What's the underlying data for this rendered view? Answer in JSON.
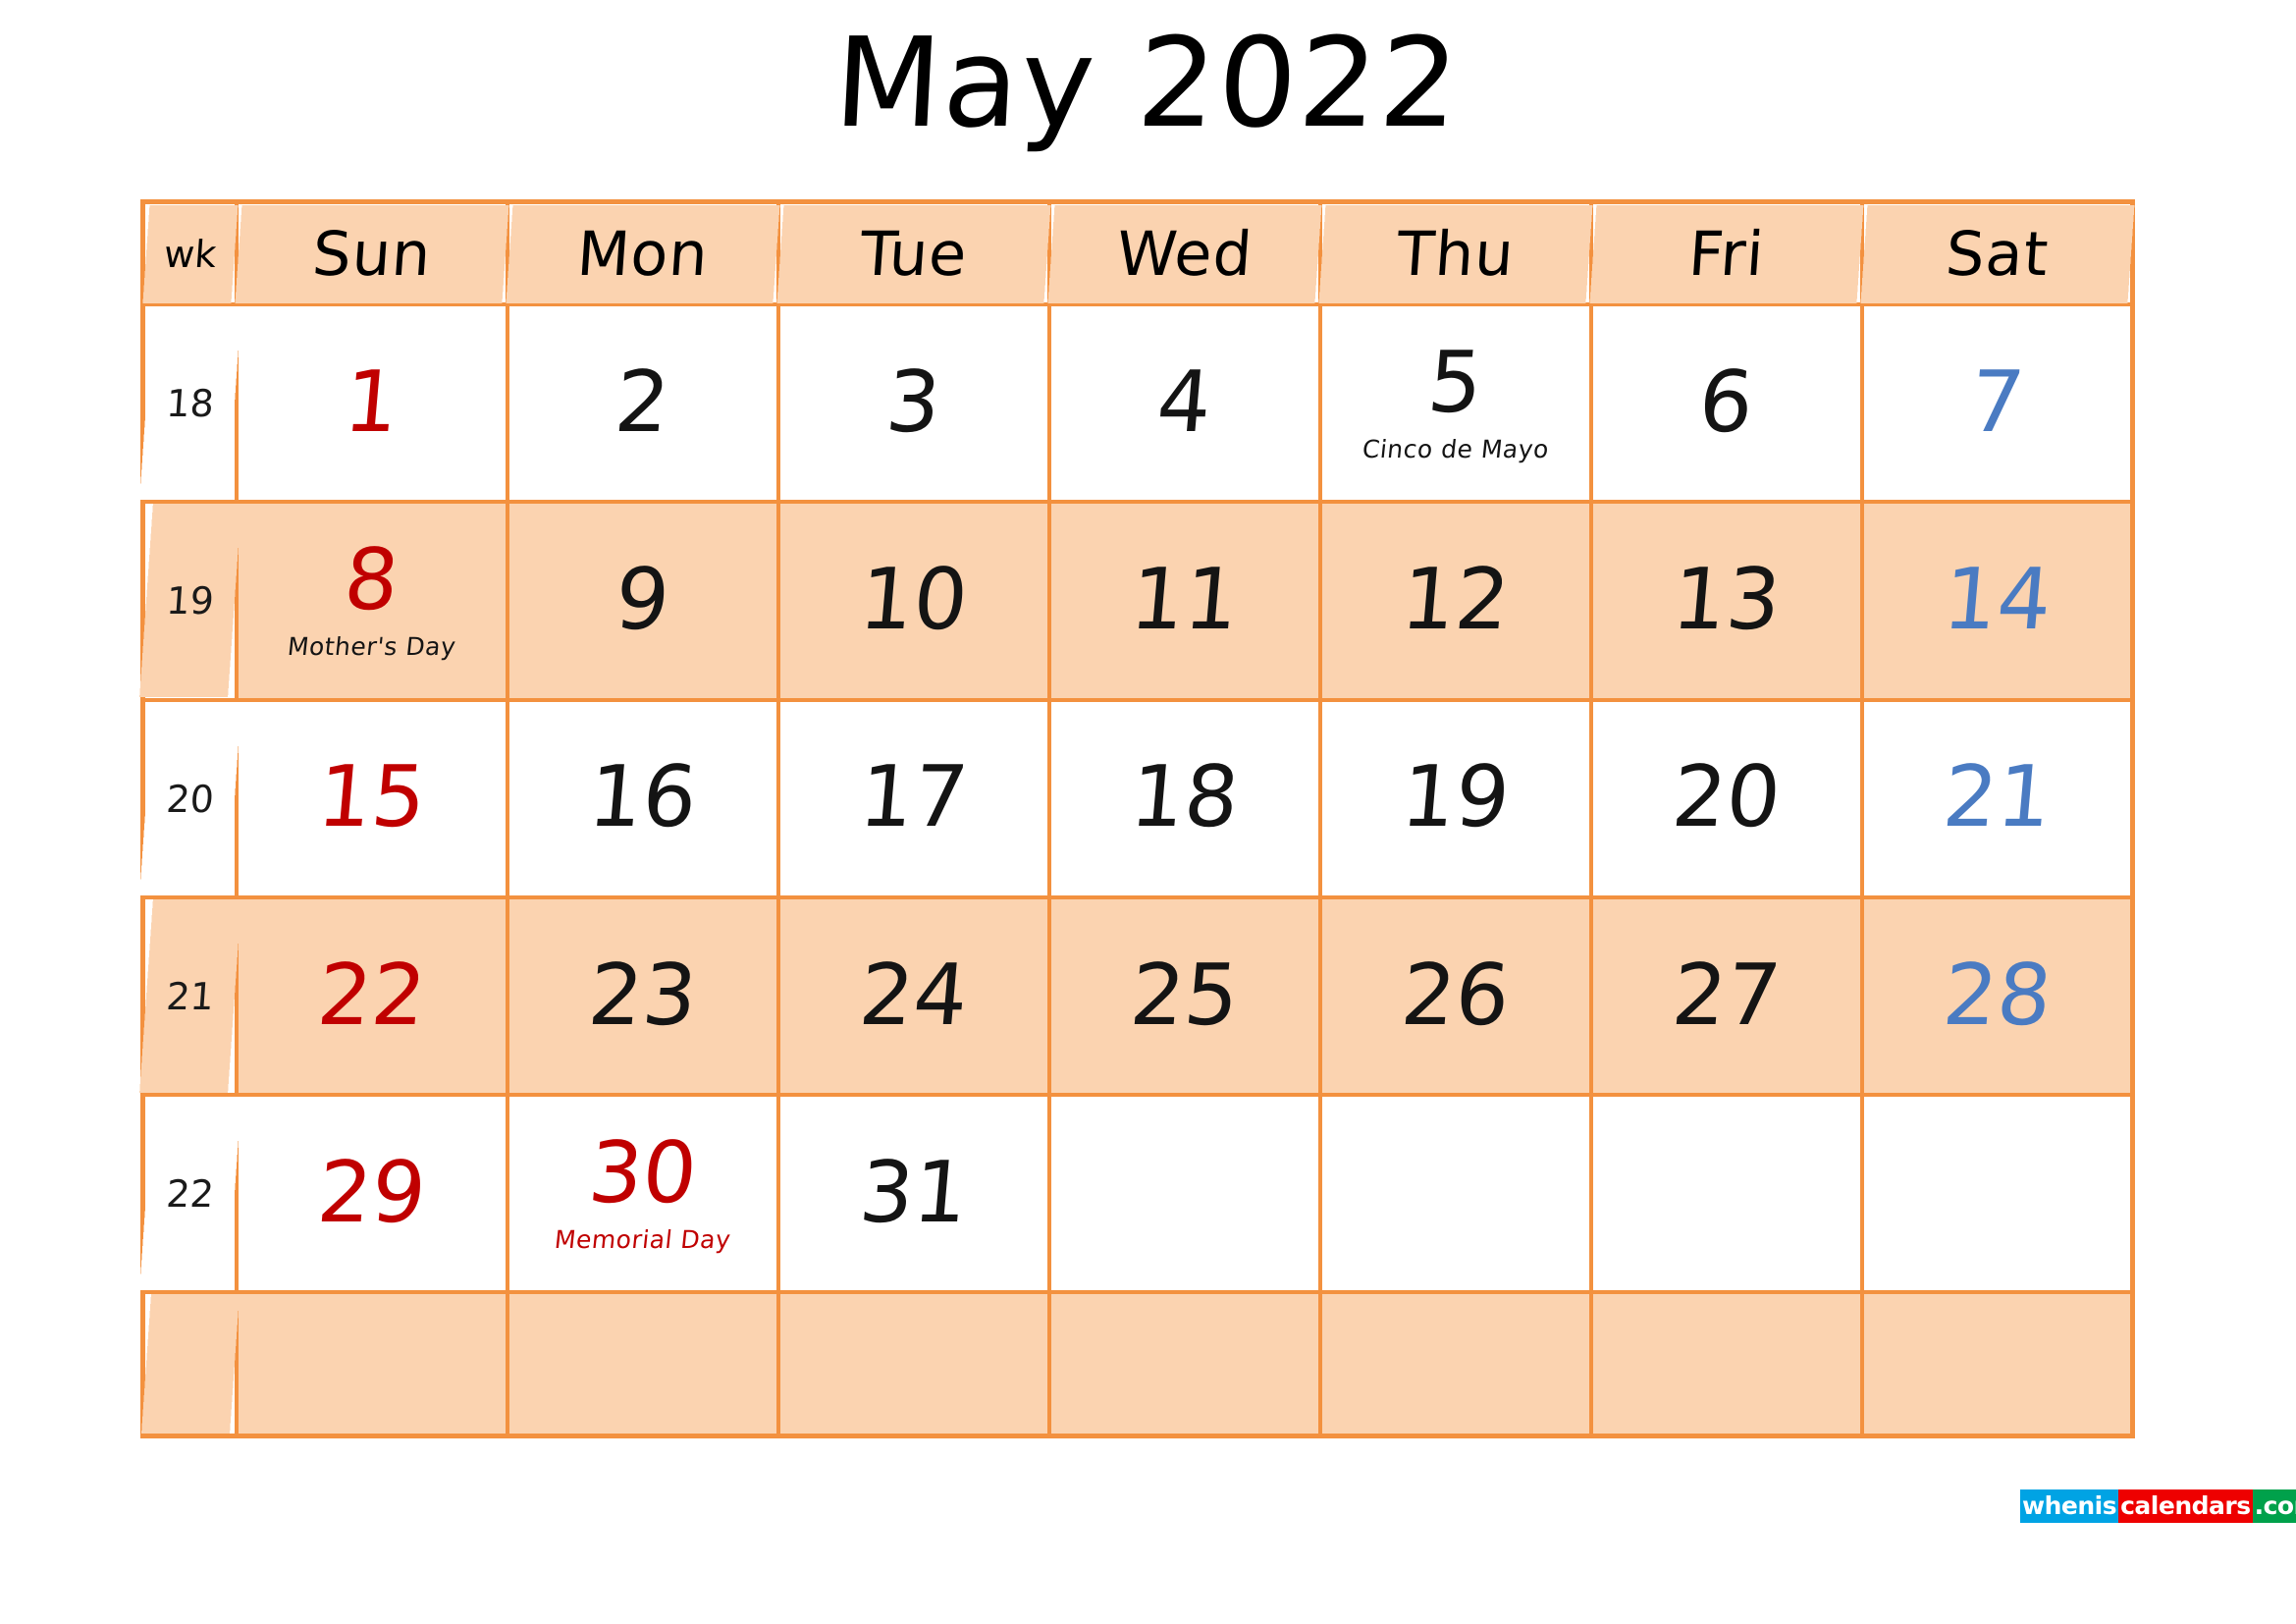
{
  "title": "May 2022",
  "colors": {
    "border": "#f3913f",
    "row_fill": "#fbd3b0",
    "sunday": "#c00000",
    "saturday": "#4a7bc2",
    "weekday": "#141414",
    "logo_blue": "#00a3e4",
    "logo_red": "#ee0000",
    "logo_green": "#00a14b"
  },
  "header": {
    "week_label": "wk",
    "days": [
      "Sun",
      "Mon",
      "Tue",
      "Wed",
      "Thu",
      "Fri",
      "Sat"
    ]
  },
  "weeks": [
    {
      "wk": "18",
      "days": [
        {
          "num": "1",
          "kind": "sunday",
          "note": ""
        },
        {
          "num": "2",
          "kind": "weekday",
          "note": ""
        },
        {
          "num": "3",
          "kind": "weekday",
          "note": ""
        },
        {
          "num": "4",
          "kind": "weekday",
          "note": ""
        },
        {
          "num": "5",
          "kind": "weekday",
          "note": "Cinco de Mayo"
        },
        {
          "num": "6",
          "kind": "weekday",
          "note": ""
        },
        {
          "num": "7",
          "kind": "saturday",
          "note": ""
        }
      ]
    },
    {
      "wk": "19",
      "days": [
        {
          "num": "8",
          "kind": "sunday",
          "note": "Mother's Day"
        },
        {
          "num": "9",
          "kind": "weekday",
          "note": ""
        },
        {
          "num": "10",
          "kind": "weekday",
          "note": ""
        },
        {
          "num": "11",
          "kind": "weekday",
          "note": ""
        },
        {
          "num": "12",
          "kind": "weekday",
          "note": ""
        },
        {
          "num": "13",
          "kind": "weekday",
          "note": ""
        },
        {
          "num": "14",
          "kind": "saturday",
          "note": ""
        }
      ]
    },
    {
      "wk": "20",
      "days": [
        {
          "num": "15",
          "kind": "sunday",
          "note": ""
        },
        {
          "num": "16",
          "kind": "weekday",
          "note": ""
        },
        {
          "num": "17",
          "kind": "weekday",
          "note": ""
        },
        {
          "num": "18",
          "kind": "weekday",
          "note": ""
        },
        {
          "num": "19",
          "kind": "weekday",
          "note": ""
        },
        {
          "num": "20",
          "kind": "weekday",
          "note": ""
        },
        {
          "num": "21",
          "kind": "saturday",
          "note": ""
        }
      ]
    },
    {
      "wk": "21",
      "days": [
        {
          "num": "22",
          "kind": "sunday",
          "note": ""
        },
        {
          "num": "23",
          "kind": "weekday",
          "note": ""
        },
        {
          "num": "24",
          "kind": "weekday",
          "note": ""
        },
        {
          "num": "25",
          "kind": "weekday",
          "note": ""
        },
        {
          "num": "26",
          "kind": "weekday",
          "note": ""
        },
        {
          "num": "27",
          "kind": "weekday",
          "note": ""
        },
        {
          "num": "28",
          "kind": "saturday",
          "note": ""
        }
      ]
    },
    {
      "wk": "22",
      "days": [
        {
          "num": "29",
          "kind": "sunday",
          "note": ""
        },
        {
          "num": "30",
          "kind": "sunday",
          "note": "Memorial Day",
          "note_color": "red"
        },
        {
          "num": "31",
          "kind": "weekday",
          "note": ""
        },
        {
          "num": "",
          "kind": "empty",
          "note": ""
        },
        {
          "num": "",
          "kind": "empty",
          "note": ""
        },
        {
          "num": "",
          "kind": "empty",
          "note": ""
        },
        {
          "num": "",
          "kind": "empty",
          "note": ""
        }
      ]
    },
    {
      "wk": "",
      "days": [
        {
          "num": "",
          "kind": "empty",
          "note": ""
        },
        {
          "num": "",
          "kind": "empty",
          "note": ""
        },
        {
          "num": "",
          "kind": "empty",
          "note": ""
        },
        {
          "num": "",
          "kind": "empty",
          "note": ""
        },
        {
          "num": "",
          "kind": "empty",
          "note": ""
        },
        {
          "num": "",
          "kind": "empty",
          "note": ""
        },
        {
          "num": "",
          "kind": "empty",
          "note": ""
        }
      ]
    }
  ],
  "logo": {
    "part1": "whenis",
    "part2": "calendars",
    "part3": ".com"
  }
}
